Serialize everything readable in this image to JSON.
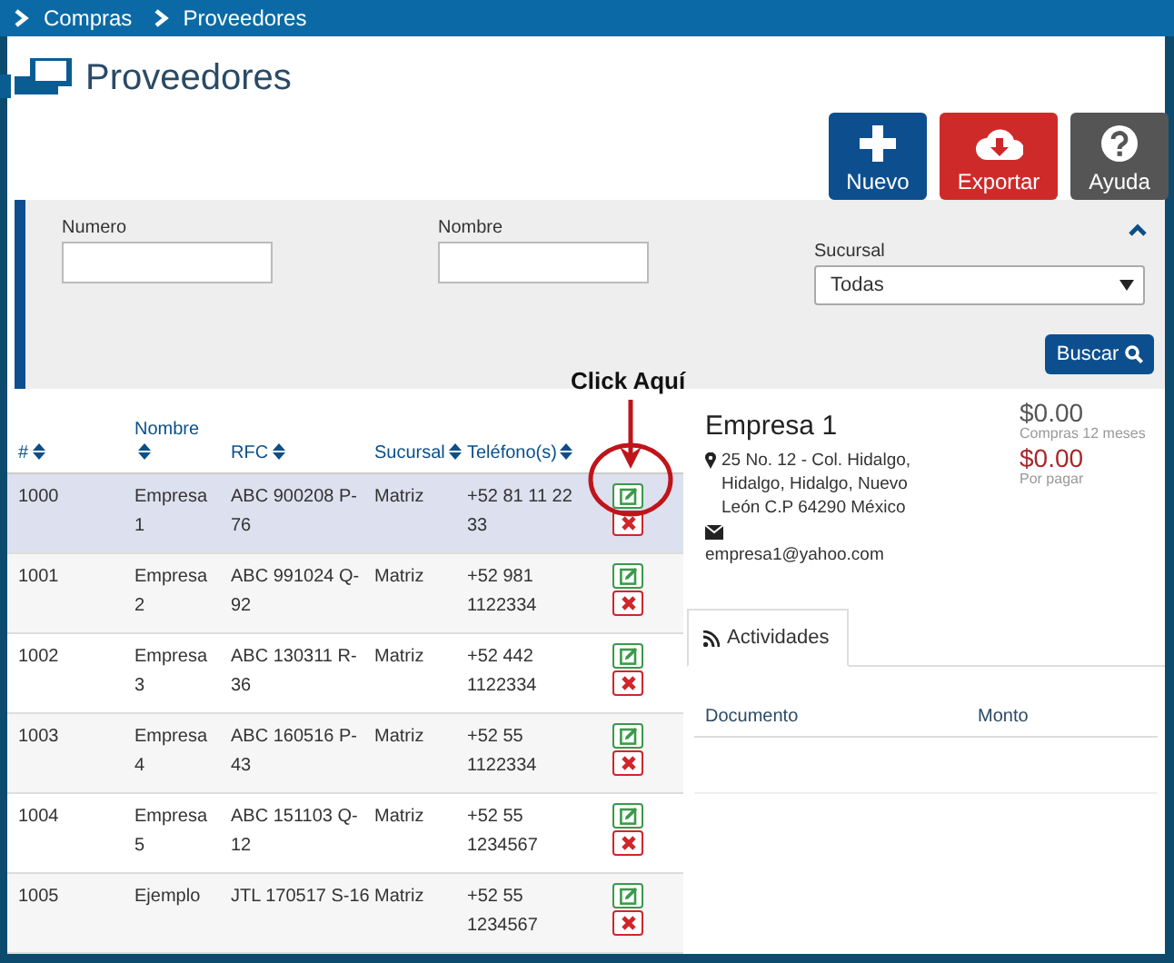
{
  "breadcrumb": [
    {
      "label": "Compras"
    },
    {
      "label": "Proveedores"
    }
  ],
  "page_title": "Proveedores",
  "toolbar": [
    {
      "label": "Nuevo",
      "kind": "new"
    },
    {
      "label": "Exportar",
      "kind": "export"
    },
    {
      "label": "Ayuda",
      "kind": "help"
    }
  ],
  "filters": {
    "expanded": true,
    "fields": [
      {
        "label": "Numero",
        "kind": "text"
      },
      {
        "label": "Nombre",
        "kind": "text"
      },
      {
        "label": "Sucursal",
        "kind": "select",
        "value": "Todas"
      }
    ],
    "button": "Buscar"
  },
  "table": {
    "columns": [
      "#",
      "Nombre",
      "RFC",
      "Sucursal",
      "Teléfono(s)"
    ],
    "rows": [
      {
        "cells": [
          "1000",
          "Empresa 1",
          "ABC 900208 P-76",
          "Matriz",
          "+52 81 11 22 33"
        ],
        "selected": true
      },
      {
        "cells": [
          "1001",
          "Empresa 2",
          "ABC 991024 Q-92",
          "Matriz",
          "+52 981 1122334"
        ],
        "selected": false
      },
      {
        "cells": [
          "1002",
          "Empresa 3",
          "ABC 130311 R-36",
          "Matriz",
          "+52 442 1122334"
        ],
        "selected": false
      },
      {
        "cells": [
          "1003",
          "Empresa 4",
          "ABC 160516 P-43",
          "Matriz",
          "+52 55 1122334"
        ],
        "selected": false
      },
      {
        "cells": [
          "1004",
          "Empresa 5",
          "ABC 151103 Q-12",
          "Matriz",
          "+52 55 1234567"
        ],
        "selected": false
      },
      {
        "cells": [
          "1005",
          "Ejemplo",
          "JTL 170517 S-16",
          "Matriz",
          "+52 55 1234567"
        ],
        "selected": false
      }
    ]
  },
  "annotation": {
    "text": "Click Aquí"
  },
  "detail": {
    "name": "Empresa 1",
    "address": "25 No. 12 - Col. Hidalgo, Hidalgo, Hidalgo, Nuevo León C.P 64290 México",
    "email": "empresa1@yahoo.com",
    "totals": [
      {
        "amount": "$0.00",
        "label": "Compras 12 meses",
        "kind": "purchases"
      },
      {
        "amount": "$0.00",
        "label": "Por pagar",
        "kind": "due"
      }
    ],
    "tabs": [
      {
        "label": "Actividades",
        "selected": true
      }
    ],
    "activity_columns": [
      "Documento",
      "Monto"
    ]
  }
}
